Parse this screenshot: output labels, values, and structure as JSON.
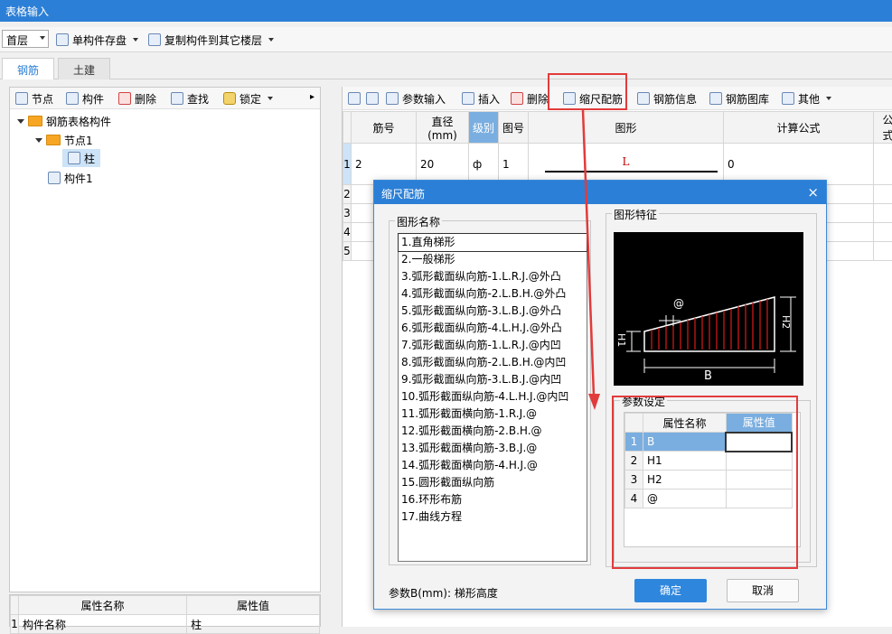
{
  "window": {
    "title": "表格输入"
  },
  "toolbar": {
    "floor": "首层",
    "save_component": "单构件存盘",
    "copy_to_floor": "复制构件到其它楼层"
  },
  "tabs": [
    {
      "label": "钢筋"
    },
    {
      "label": "土建"
    }
  ],
  "left_toolbar": {
    "node": "节点",
    "component": "构件",
    "delete": "删除",
    "find": "查找",
    "lock": "锁定"
  },
  "tree": {
    "root": "钢筋表格构件",
    "node1": "节点1",
    "column": "柱",
    "component1": "构件1"
  },
  "props": {
    "col_name": "属性名称",
    "col_value": "属性值",
    "row1_name": "构件名称",
    "row1_value": "柱",
    "row1_num": "1"
  },
  "right_toolbar": {
    "param_input": "参数输入",
    "insert": "插入",
    "delete": "删除",
    "scale_rebar": "缩尺配筋",
    "rebar_info": "钢筋信息",
    "rebar_lib": "钢筋图库",
    "other": "其他"
  },
  "grid": {
    "headers": [
      "筋号",
      "直径(mm)",
      "级别",
      "图号",
      "图形",
      "计算公式",
      "公式"
    ],
    "row1": {
      "num": "1",
      "bar": "2",
      "dia": "20",
      "grade": "ф",
      "fig": "1",
      "shape_label": "L",
      "formula": "0"
    },
    "row_nums": [
      "2",
      "3",
      "4",
      "5"
    ]
  },
  "dialog": {
    "title": "缩尺配筋",
    "close": "×",
    "shape_group": "图形名称",
    "shapes": [
      "1.直角梯形",
      "2.一般梯形",
      "3.弧形截面纵向筋-1.L.R.J.@外凸",
      "4.弧形截面纵向筋-2.L.B.H.@外凸",
      "5.弧形截面纵向筋-3.L.B.J.@外凸",
      "6.弧形截面纵向筋-4.L.H.J.@外凸",
      "7.弧形截面纵向筋-1.L.R.J.@内凹",
      "8.弧形截面纵向筋-2.L.B.H.@内凹",
      "9.弧形截面纵向筋-3.L.B.J.@内凹",
      "10.弧形截面纵向筋-4.L.H.J.@内凹",
      "11.弧形截面横向筋-1.R.J.@",
      "12.弧形截面横向筋-2.B.H.@",
      "13.弧形截面横向筋-3.B.J.@",
      "14.弧形截面横向筋-4.H.J.@",
      "15.圆形截面纵向筋",
      "16.环形布筋",
      "17.曲线方程"
    ],
    "feature_group": "图形特征",
    "diagram": {
      "at": "@",
      "h1": "H1",
      "h2": "H2",
      "b": "B"
    },
    "param_group": "参数设定",
    "param_headers": {
      "name": "属性名称",
      "value": "属性值"
    },
    "params": [
      {
        "num": "1",
        "name": "B",
        "value": ""
      },
      {
        "num": "2",
        "name": "H1",
        "value": ""
      },
      {
        "num": "3",
        "name": "H2",
        "value": ""
      },
      {
        "num": "4",
        "name": "@",
        "value": ""
      }
    ],
    "hint": "参数B(mm): 梯形高度",
    "ok": "确定",
    "cancel": "取消"
  },
  "colors": {
    "accent": "#2b7fd6",
    "annotation": "#e23b3b"
  }
}
